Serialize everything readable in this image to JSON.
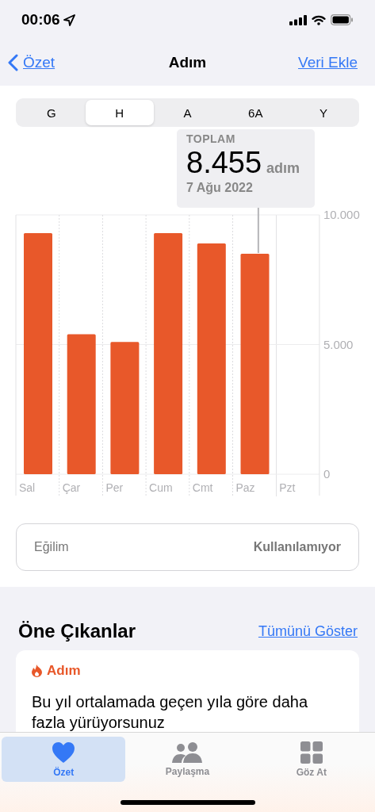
{
  "status_bar": {
    "time": "00:06"
  },
  "nav": {
    "back": "Özet",
    "title": "Adım",
    "action": "Veri Ekle"
  },
  "segments": [
    {
      "label": "G",
      "selected": false
    },
    {
      "label": "H",
      "selected": true
    },
    {
      "label": "A",
      "selected": false
    },
    {
      "label": "6A",
      "selected": false
    },
    {
      "label": "Y",
      "selected": false
    }
  ],
  "tooltip": {
    "label": "TOPLAM",
    "value": "8.455",
    "unit": "adım",
    "date": "7 Ağu 2022"
  },
  "chart_data": {
    "type": "bar",
    "categories": [
      "Sal",
      "Çar",
      "Per",
      "Cum",
      "Cmt",
      "Paz",
      "Pzt"
    ],
    "series": [
      {
        "color": "#e8582a",
        "values": [
          9300,
          5400,
          5100,
          9300,
          8900,
          8500,
          null
        ]
      }
    ],
    "ylim": [
      0,
      10000
    ],
    "yticks": [
      {
        "value": 0,
        "label": "0"
      },
      {
        "value": 5000,
        "label": "5.000"
      },
      {
        "value": 10000,
        "label": "10.000"
      }
    ],
    "annotations": [
      {
        "x": "Paz"
      }
    ]
  },
  "trend": {
    "label": "Eğilim",
    "value": "Kullanılamıyor"
  },
  "highlights": {
    "title": "Öne Çıkanlar",
    "link": "Tümünü Göster",
    "card": {
      "category": "Adım",
      "text": "Bu yıl ortalamada geçen yıla göre daha fazla yürüyorsunuz"
    }
  },
  "tab_bar": [
    {
      "label": "Özet",
      "kind": "heart",
      "selected": true
    },
    {
      "label": "Paylaşma",
      "kind": "people",
      "selected": false
    },
    {
      "label": "Göz At",
      "kind": "grid",
      "selected": false
    }
  ]
}
